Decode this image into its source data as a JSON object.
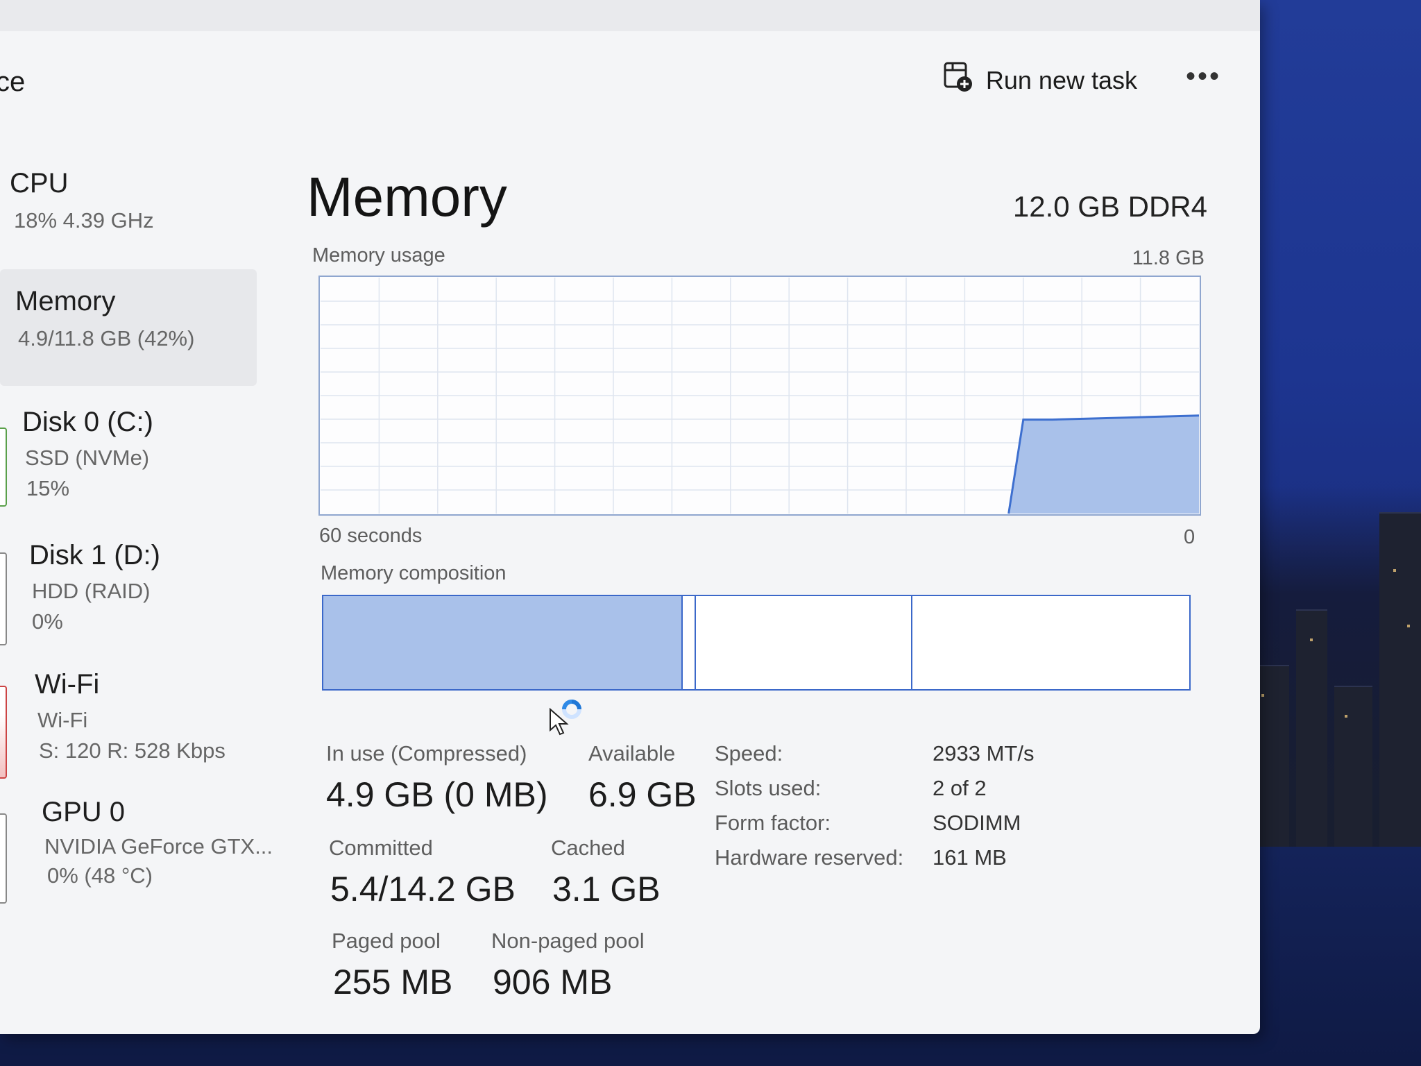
{
  "header": {
    "title_fragment": "ce",
    "run_task_label": "Run new task",
    "more_label": "•••"
  },
  "sidebar": {
    "items": [
      {
        "title": "CPU",
        "sub1": "18% 4.39 GHz",
        "sub2": ""
      },
      {
        "title": "Memory",
        "sub1": "4.9/11.8 GB (42%)",
        "sub2": ""
      },
      {
        "title": "Disk 0 (C:)",
        "sub1": "SSD (NVMe)",
        "sub2": "15%"
      },
      {
        "title": "Disk 1 (D:)",
        "sub1": "HDD (RAID)",
        "sub2": "0%"
      },
      {
        "title": "Wi-Fi",
        "sub1": "Wi-Fi",
        "sub2": "S: 120 R: 528 Kbps"
      },
      {
        "title": "GPU 0",
        "sub1": "NVIDIA GeForce GTX...",
        "sub2": "0% (48 °C)"
      }
    ],
    "active_index": 1
  },
  "main": {
    "title": "Memory",
    "spec": "12.0 GB DDR4",
    "usage_label": "Memory usage",
    "usage_max": "11.8 GB",
    "x_left": "60 seconds",
    "x_right": "0",
    "composition_label": "Memory composition"
  },
  "chart_data": {
    "type": "area",
    "title": "Memory usage",
    "ylabel": "",
    "xlabel": "",
    "x_range_label": [
      "60 seconds",
      "0"
    ],
    "ylim": [
      0,
      11.8
    ],
    "y_unit": "GB",
    "series": [
      {
        "values_seconds_ago": [
          60,
          55,
          50,
          45,
          40,
          35,
          30,
          25,
          20,
          15,
          13,
          12,
          10,
          5,
          0
        ],
        "values": [
          null,
          null,
          null,
          null,
          null,
          null,
          null,
          null,
          null,
          null,
          0.0,
          4.7,
          4.7,
          4.8,
          4.9
        ]
      }
    ],
    "grid": true,
    "color": "#a9c1ea",
    "line_color": "#3d6fcf",
    "composition": {
      "total_gb": 11.8,
      "in_use_gb": 4.9,
      "modified_fraction": 0.015,
      "standby_gb": 3.1,
      "free_fraction": 0.32
    }
  },
  "stats": {
    "in_use_label": "In use (Compressed)",
    "in_use_value": "4.9 GB (0 MB)",
    "available_label": "Available",
    "available_value": "6.9 GB",
    "committed_label": "Committed",
    "committed_value": "5.4/14.2 GB",
    "cached_label": "Cached",
    "cached_value": "3.1 GB",
    "paged_label": "Paged pool",
    "paged_value": "255 MB",
    "nonpaged_label": "Non-paged pool",
    "nonpaged_value": "906 MB"
  },
  "details": {
    "speed_key": "Speed:",
    "speed_val": "2933 MT/s",
    "slots_key": "Slots used:",
    "slots_val": "2 of 2",
    "form_key": "Form factor:",
    "form_val": "SODIMM",
    "hw_key": "Hardware reserved:",
    "hw_val": "161 MB"
  },
  "colors": {
    "accent": "#3d6fcf",
    "fill": "#a9c1ea",
    "window_bg": "#f4f5f7"
  }
}
